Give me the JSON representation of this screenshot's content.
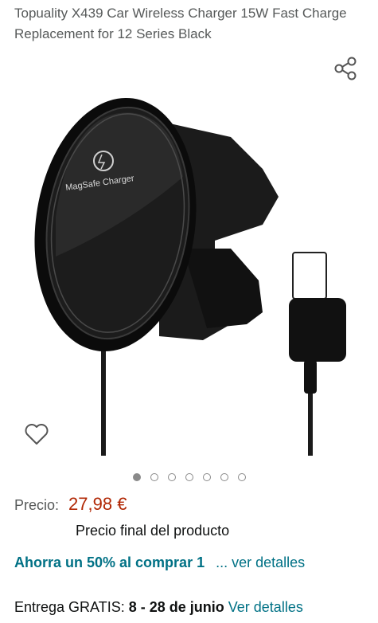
{
  "product": {
    "title": "Topuality X439 Car Wireless Charger 15W Fast Charge Replacement for 12 Series Black",
    "image_label": "MagSafe Charger",
    "image_count": 7,
    "active_image_index": 0
  },
  "icons": {
    "share": "share-icon",
    "favorite": "heart-icon"
  },
  "price": {
    "label": "Precio:",
    "value": "27,98 €",
    "note": "Precio final del producto"
  },
  "promo": {
    "text": "Ahorra un 50% al comprar 1",
    "link": "... ver detalles"
  },
  "delivery": {
    "prefix": "Entrega GRATIS: ",
    "dates": "8 - 28 de junio",
    "link": "Ver detalles"
  },
  "colors": {
    "price": "#b12704",
    "link": "#007185"
  }
}
